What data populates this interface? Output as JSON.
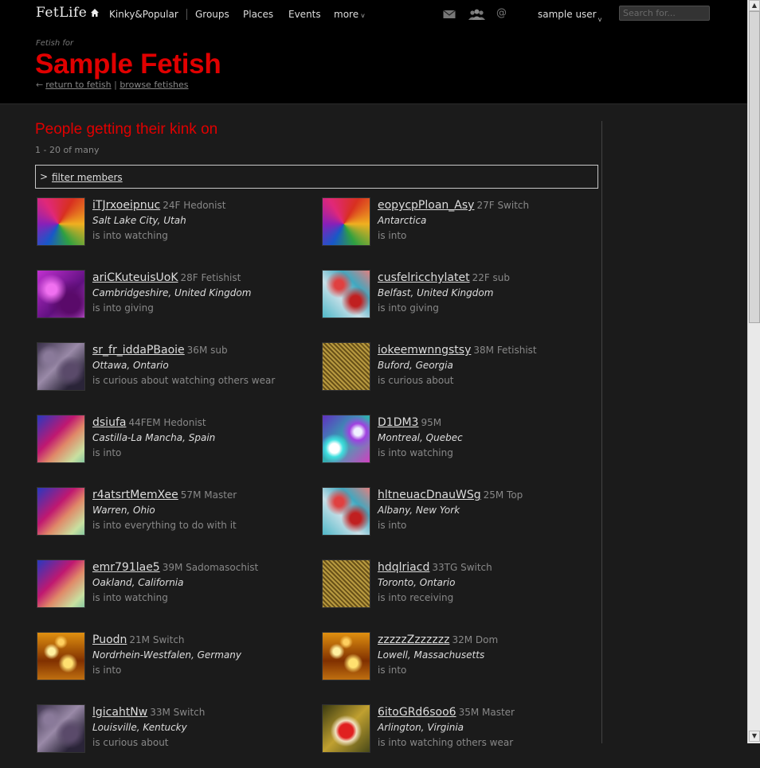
{
  "header": {
    "logo": "FetLife",
    "nav": [
      {
        "label": "Kinky&Popular"
      },
      {
        "label": "Groups"
      },
      {
        "label": "Places"
      },
      {
        "label": "Events"
      },
      {
        "label": "more"
      }
    ],
    "more_caret": "v",
    "at_glyph": "@",
    "user_label": "sample user",
    "user_caret": "v",
    "search_placeholder": "Search for..."
  },
  "fetish": {
    "prefix": "Fetish for",
    "title": "Sample Fetish",
    "arrow": "←",
    "return_label": "return to fetish",
    "separator": "|",
    "browse_label": "browse fetishes"
  },
  "section": {
    "title": "People getting their kink on",
    "count": "1 - 20 of many",
    "filter_caret": ">",
    "filter_label": "filter members"
  },
  "members": [
    {
      "name": "iTJrxoeipnuc",
      "meta": "24F Hedonist",
      "location": "Salt Lake City, Utah",
      "interest": "is into watching",
      "avatar": "swirl"
    },
    {
      "name": "eopycpPloan_Asy",
      "meta": "27F Switch",
      "location": "Antarctica",
      "interest": "is into",
      "avatar": "swirl"
    },
    {
      "name": "ariCKuteuisUoK",
      "meta": "28F Fetishist",
      "location": "Cambridgeshire, United Kingdom",
      "interest": "is into giving",
      "avatar": "purple"
    },
    {
      "name": "cusfelricchylatet",
      "meta": "22F sub",
      "location": "Belfast, United Kingdom",
      "interest": "is into giving",
      "avatar": "cyanred"
    },
    {
      "name": "sr_fr_iddaPBaoie",
      "meta": "36M sub",
      "location": "Ottawa, Ontario",
      "interest": "is curious about watching others wear",
      "avatar": "texture"
    },
    {
      "name": "iokeemwnngstsy",
      "meta": "38M Fetishist",
      "location": "Buford, Georgia",
      "interest": "is curious about",
      "avatar": "gold"
    },
    {
      "name": "dsiufa",
      "meta": "44FEM Hedonist",
      "location": "Castilla-La Mancha, Spain",
      "interest": "is into",
      "avatar": "prism"
    },
    {
      "name": "D1DM3",
      "meta": "95M",
      "location": "Montreal, Quebec",
      "interest": "is into watching",
      "avatar": "bubbles"
    },
    {
      "name": "r4atsrtMemXee",
      "meta": "57M Master",
      "location": "Warren, Ohio",
      "interest": "is into everything to do with it",
      "avatar": "prism"
    },
    {
      "name": "hltneuacDnauWSg",
      "meta": "25M Top",
      "location": "Albany, New York",
      "interest": "is into",
      "avatar": "cyanred"
    },
    {
      "name": "emr791lae5",
      "meta": "39M Sadomasochist",
      "location": "Oakland, California",
      "interest": "is into watching",
      "avatar": "prism"
    },
    {
      "name": "hdqlriacd",
      "meta": "33TG Switch",
      "location": "Toronto, Ontario",
      "interest": "is into receiving",
      "avatar": "gold"
    },
    {
      "name": "Puodn",
      "meta": "21M Switch",
      "location": "Nordrhein-Westfalen, Germany",
      "interest": "is into",
      "avatar": "bokeh"
    },
    {
      "name": "zzzzzZzzzzzz",
      "meta": "32M Dom",
      "location": "Lowell, Massachusetts",
      "interest": "is into",
      "avatar": "bokeh"
    },
    {
      "name": "lgicahtNw",
      "meta": "33M Switch",
      "location": "Louisville, Kentucky",
      "interest": "is curious about",
      "avatar": "texture"
    },
    {
      "name": "6itoGRd6soo6",
      "meta": "35M Master",
      "location": "Arlington, Virginia",
      "interest": "is into watching others wear",
      "avatar": "flower"
    }
  ],
  "colors": {
    "accent_red": "#e00000",
    "background": "#1b1b1b",
    "header_bg": "#000000"
  }
}
